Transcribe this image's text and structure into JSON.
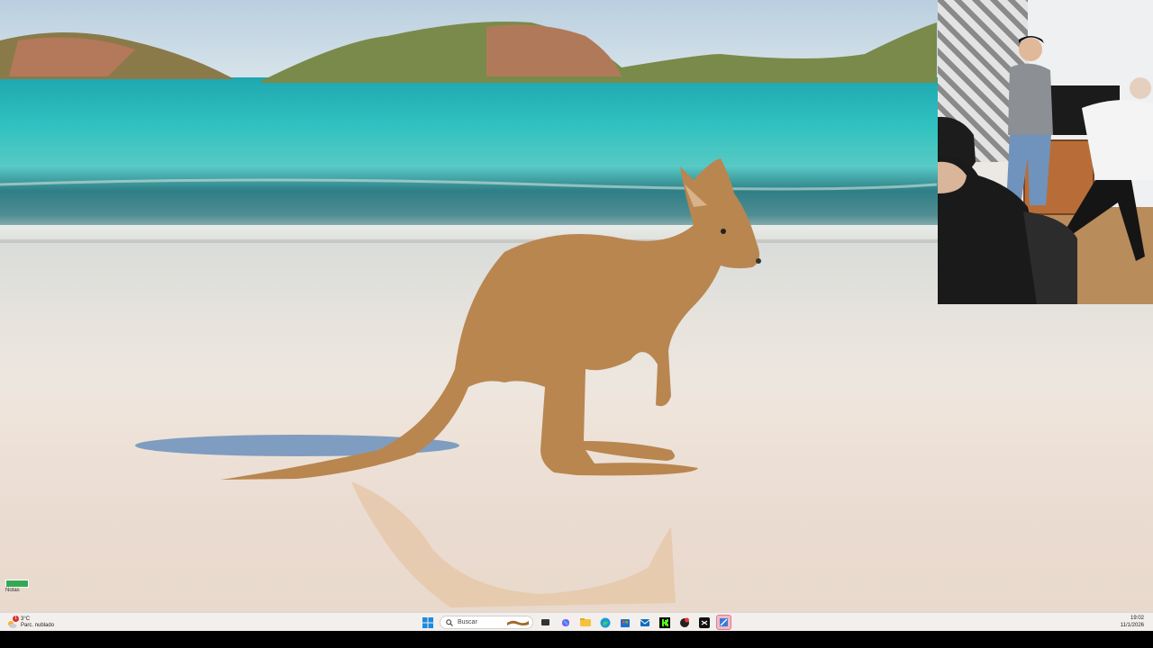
{
  "desktop": {
    "widget_label": "Notas"
  },
  "taskbar": {
    "weather": {
      "temperature": "3°C",
      "condition": "Parc. nublado",
      "badge_count": "1",
      "icon": "cloud-sun-icon"
    },
    "start_icon": "windows-start-icon",
    "search": {
      "placeholder": "Buscar",
      "icon": "search-icon"
    },
    "apps": [
      {
        "name": "task-view",
        "icon": "task-view-icon"
      },
      {
        "name": "copilot",
        "icon": "copilot-icon"
      },
      {
        "name": "file-explorer",
        "icon": "folder-icon"
      },
      {
        "name": "edge",
        "icon": "edge-icon"
      },
      {
        "name": "microsoft-store",
        "icon": "store-icon"
      },
      {
        "name": "outlook",
        "icon": "mail-icon"
      },
      {
        "name": "kick",
        "icon": "kick-icon"
      },
      {
        "name": "chrome-like-app",
        "icon": "app-red-icon"
      },
      {
        "name": "capcut",
        "icon": "capcut-icon"
      },
      {
        "name": "snipping-tool",
        "icon": "snip-icon",
        "active": true
      }
    ],
    "clock": {
      "time": "19:02",
      "date": "11/1/2026"
    }
  },
  "colors": {
    "taskbar_bg": "#f3efec",
    "active_app_bg": "#f0b9c6",
    "kick_green": "#53fc18"
  }
}
